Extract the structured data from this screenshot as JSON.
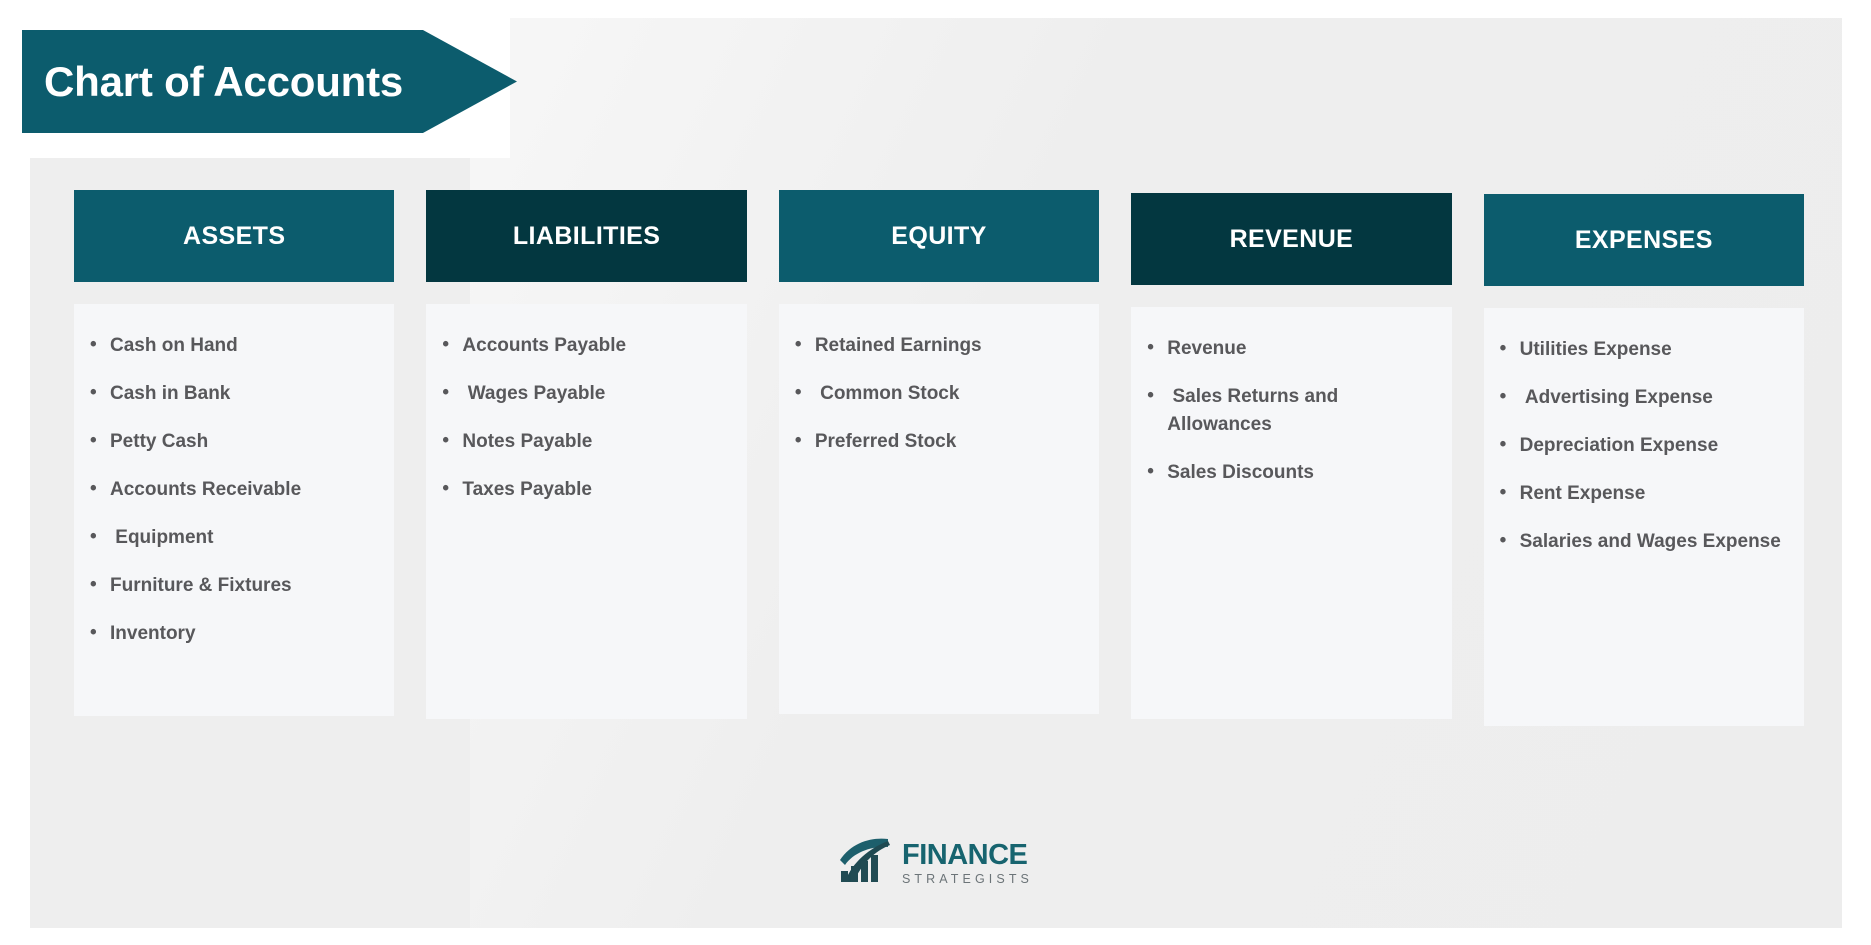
{
  "title": "Chart of Accounts",
  "colors": {
    "teal": "#0c5c6d",
    "dark_teal": "#033740",
    "panel_bg": "#f6f7f9",
    "canvas_bg": "#eeeeee",
    "text_gray": "#58585b",
    "logo_teal": "#17646f"
  },
  "columns": [
    {
      "header": "ASSETS",
      "tone": "teal",
      "items": [
        "Cash on Hand",
        "Cash in Bank",
        "Petty Cash",
        "Accounts Receivable",
        " Equipment",
        "Furniture & Fixtures",
        "Inventory"
      ]
    },
    {
      "header": "LIABILITIES",
      "tone": "dark",
      "items": [
        "Accounts Payable",
        " Wages Payable",
        "Notes Payable",
        "Taxes Payable"
      ]
    },
    {
      "header": "EQUITY",
      "tone": "teal",
      "items": [
        "Retained Earnings",
        " Common Stock",
        "Preferred Stock"
      ]
    },
    {
      "header": "REVENUE",
      "tone": "dark",
      "items": [
        "Revenue",
        " Sales Returns and Allowances",
        "Sales Discounts"
      ]
    },
    {
      "header": "EXPENSES",
      "tone": "teal",
      "items": [
        "Utilities Expense",
        " Advertising Expense",
        "Depreciation Expense",
        "Rent Expense",
        "Salaries and Wages Expense"
      ]
    }
  ],
  "logo": {
    "mark": "finance-strategists-mark",
    "word_primary": "FINANCE",
    "word_secondary": "STRATEGISTS"
  }
}
